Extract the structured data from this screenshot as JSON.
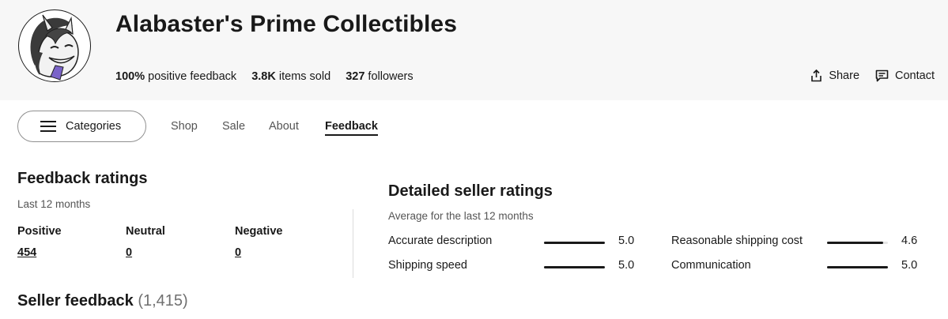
{
  "store": {
    "name": "Alabaster's Prime Collectibles",
    "stats": [
      {
        "value": "100%",
        "label": "positive feedback"
      },
      {
        "value": "3.8K",
        "label": "items sold"
      },
      {
        "value": "327",
        "label": "followers"
      }
    ],
    "share_label": "Share",
    "contact_label": "Contact"
  },
  "nav": {
    "categories_label": "Categories",
    "tabs": [
      {
        "label": "Shop"
      },
      {
        "label": "Sale"
      },
      {
        "label": "About"
      },
      {
        "label": "Feedback",
        "active": true
      }
    ]
  },
  "feedback_ratings": {
    "title": "Feedback ratings",
    "period": "Last 12 months",
    "positive": {
      "label": "Positive",
      "value": "454"
    },
    "neutral": {
      "label": "Neutral",
      "value": "0"
    },
    "negative": {
      "label": "Negative",
      "value": "0"
    }
  },
  "detailed_ratings": {
    "title": "Detailed seller ratings",
    "subtitle": "Average for the last 12 months",
    "items": [
      {
        "label": "Accurate description",
        "score": "5.0",
        "value": 5.0
      },
      {
        "label": "Reasonable shipping cost",
        "score": "4.6",
        "value": 4.6
      },
      {
        "label": "Shipping speed",
        "score": "5.0",
        "value": 5.0
      },
      {
        "label": "Communication",
        "score": "5.0",
        "value": 5.0
      }
    ],
    "max": 5
  },
  "seller_feedback": {
    "title": "Seller feedback",
    "count": "(1,415)"
  },
  "colors": {
    "header_bg": "#f7f7f7",
    "text": "#191919",
    "muted": "#555555",
    "bar_track": "#e5e5e5"
  }
}
